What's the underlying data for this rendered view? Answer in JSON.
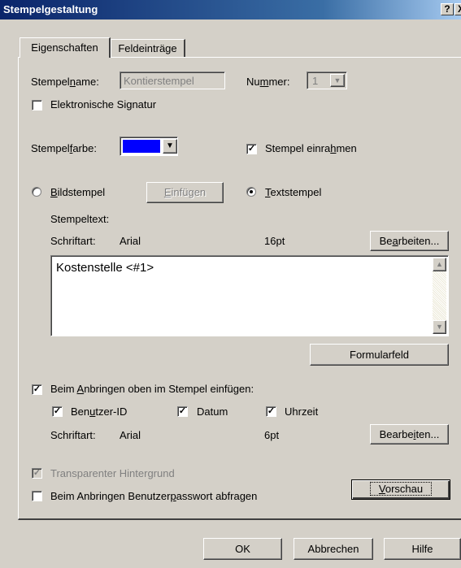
{
  "window": {
    "title": "Stempelgestaltung",
    "help_glyph": "?",
    "close_glyph": "X"
  },
  "tabs": [
    {
      "label": "Eigenschaften",
      "active": true
    },
    {
      "label": "Feldeinträge",
      "active": false
    }
  ],
  "stamp": {
    "name_label_pre": "Stempel",
    "name_label_u": "n",
    "name_label_post": "ame:",
    "name_value": "Kontierstempel",
    "number_label_pre": "Nu",
    "number_label_u": "m",
    "number_label_post": "mer:",
    "number_value": "1",
    "esign_label": "Elektronische Signatur",
    "esign_checked": false,
    "color_label_pre": "Stempel",
    "color_label_u": "f",
    "color_label_post": "arbe:",
    "color_value": "#0000ff",
    "frame_label_pre": "Stempel einra",
    "frame_label_u": "h",
    "frame_label_post": "men",
    "frame_checked": true
  },
  "stamp_type": {
    "image_label_u": "B",
    "image_label_post": "ildstempel",
    "image_selected": false,
    "insert_label_u": "E",
    "insert_label_post": "infügen",
    "text_label_u": "T",
    "text_label_post": "extstempel",
    "text_selected": true
  },
  "stamp_text": {
    "section_label": "Stempeltext:",
    "font_label": "Schriftart:",
    "font_name": "Arial",
    "font_size": "16pt",
    "edit_label_pre": "Be",
    "edit_label_u": "a",
    "edit_label_post": "rbeiten...",
    "content": "Kostenstelle <#1>",
    "form_field_label": "Formularfeld"
  },
  "header_insert": {
    "label_pre": "Beim ",
    "label_u": "A",
    "label_post": "nbringen oben im Stempel einfügen:",
    "checked": true,
    "user_id_pre": "Ben",
    "user_id_u": "u",
    "user_id_post": "tzer-ID",
    "user_id_checked": true,
    "date_label": "Datum",
    "date_checked": true,
    "time_label": "Uhrzeit",
    "time_checked": true,
    "font_label": "Schriftart:",
    "font_name": "Arial",
    "font_size": "6pt",
    "edit_label_pre": "Bearbe",
    "edit_label_u": "i",
    "edit_label_post": "ten..."
  },
  "options": {
    "transparent_label": "Transparenter Hintergrund",
    "transparent_checked": true,
    "password_label_pre": "Beim Anbringen Benutzer",
    "password_label_u": "p",
    "password_label_post": "asswort abfragen",
    "password_checked": false,
    "preview_label_u": "V",
    "preview_label_post": "orschau"
  },
  "footer": {
    "ok_label": "OK",
    "cancel_label": "Abbrechen",
    "help_label": "Hilfe"
  },
  "glyphs": {
    "check": "✓",
    "down_arrow": "▼",
    "up_arrow": "▲"
  }
}
